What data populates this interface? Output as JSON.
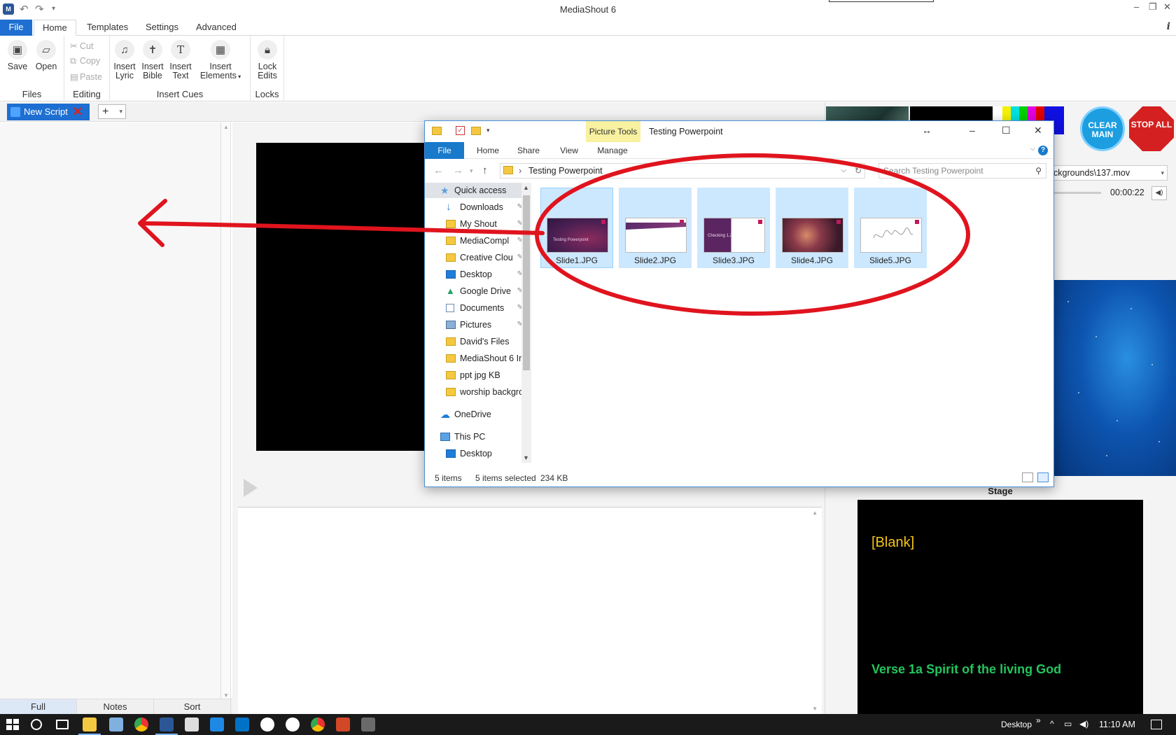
{
  "app": {
    "title": "MediaShout 6",
    "qa_more": "▾"
  },
  "menu": {
    "tabs": [
      "File",
      "Home",
      "Templates",
      "Settings",
      "Advanced"
    ],
    "active": "Home"
  },
  "ribbon": {
    "files": {
      "label": "Files",
      "save": "Save",
      "open": "Open"
    },
    "editing": {
      "label": "Editing",
      "cut": "Cut",
      "copy": "Copy",
      "paste": "Paste"
    },
    "insert_cues": {
      "label": "Insert Cues",
      "lyric_1": "Insert",
      "lyric_2": "Lyric",
      "bible_1": "Insert",
      "bible_2": "Bible",
      "text_1": "Insert",
      "text_2": "Text",
      "elements_1": "Insert",
      "elements_2": "Elements"
    },
    "locks": {
      "label": "Locks",
      "lock_1": "Lock",
      "lock_2": "Edits"
    }
  },
  "script_tab": {
    "label": "New Script",
    "add": "+"
  },
  "view_tabs": [
    "Full",
    "Notes",
    "Sort"
  ],
  "right": {
    "clear_main": "CLEAR MAIN",
    "stop_all": "STOP ALL",
    "media_path": "ckgrounds\\137.mov",
    "timecode": "00:00:22",
    "stage_label": "Stage",
    "stage_blank": "[Blank]",
    "stage_verse": "Verse 1a Spirit of the living God"
  },
  "explorer": {
    "picture_tools": "Picture Tools",
    "window_title": "Testing Powerpoint",
    "ribbon_tabs": [
      "File",
      "Home",
      "Share",
      "View",
      "Manage"
    ],
    "path": "Testing Powerpoint",
    "search_placeholder": "Search Testing Powerpoint",
    "nav": [
      {
        "label": "Quick access",
        "icon": "star-icon"
      },
      {
        "label": "Downloads",
        "icon": "download-icon",
        "pinned": true
      },
      {
        "label": "My Shout",
        "icon": "folder-icon",
        "pinned": true
      },
      {
        "label": "MediaCompl",
        "icon": "folder-icon",
        "pinned": true
      },
      {
        "label": "Creative Clou",
        "icon": "folder-icon",
        "pinned": true
      },
      {
        "label": "Desktop",
        "icon": "desktop-icon",
        "pinned": true
      },
      {
        "label": "Google Drive",
        "icon": "google-drive-icon",
        "pinned": true
      },
      {
        "label": "Documents",
        "icon": "documents-icon",
        "pinned": true
      },
      {
        "label": "Pictures",
        "icon": "pictures-icon",
        "pinned": true
      },
      {
        "label": "David's Files",
        "icon": "folder-icon"
      },
      {
        "label": "MediaShout 6 In",
        "icon": "folder-icon"
      },
      {
        "label": "ppt jpg KB",
        "icon": "folder-icon"
      },
      {
        "label": "worship backgro",
        "icon": "folder-icon"
      },
      {
        "label": "OneDrive",
        "icon": "onedrive-icon"
      },
      {
        "label": "This PC",
        "icon": "pc-icon"
      },
      {
        "label": "Desktop",
        "icon": "desktop-icon"
      }
    ],
    "files": [
      {
        "name": "Slide1.JPG",
        "caption": "Testing Powerpoint"
      },
      {
        "name": "Slide2.JPG",
        "caption": ""
      },
      {
        "name": "Slide3.JPG",
        "caption": "Checking 1,2"
      },
      {
        "name": "Slide4.JPG",
        "caption": ""
      },
      {
        "name": "Slide5.JPG",
        "caption": ""
      }
    ],
    "status_count": "5 items",
    "status_selected": "5 items selected",
    "status_size": "234 KB"
  },
  "taskbar": {
    "desktop_label": "Desktop",
    "clock": "11:10 AM"
  },
  "colors": {
    "accent_blue": "#1e6fd1",
    "annotation_red": "#e0141e",
    "selection": "#cce8ff",
    "stage_blank": "#f5c518",
    "stage_verse": "#22c55e"
  }
}
